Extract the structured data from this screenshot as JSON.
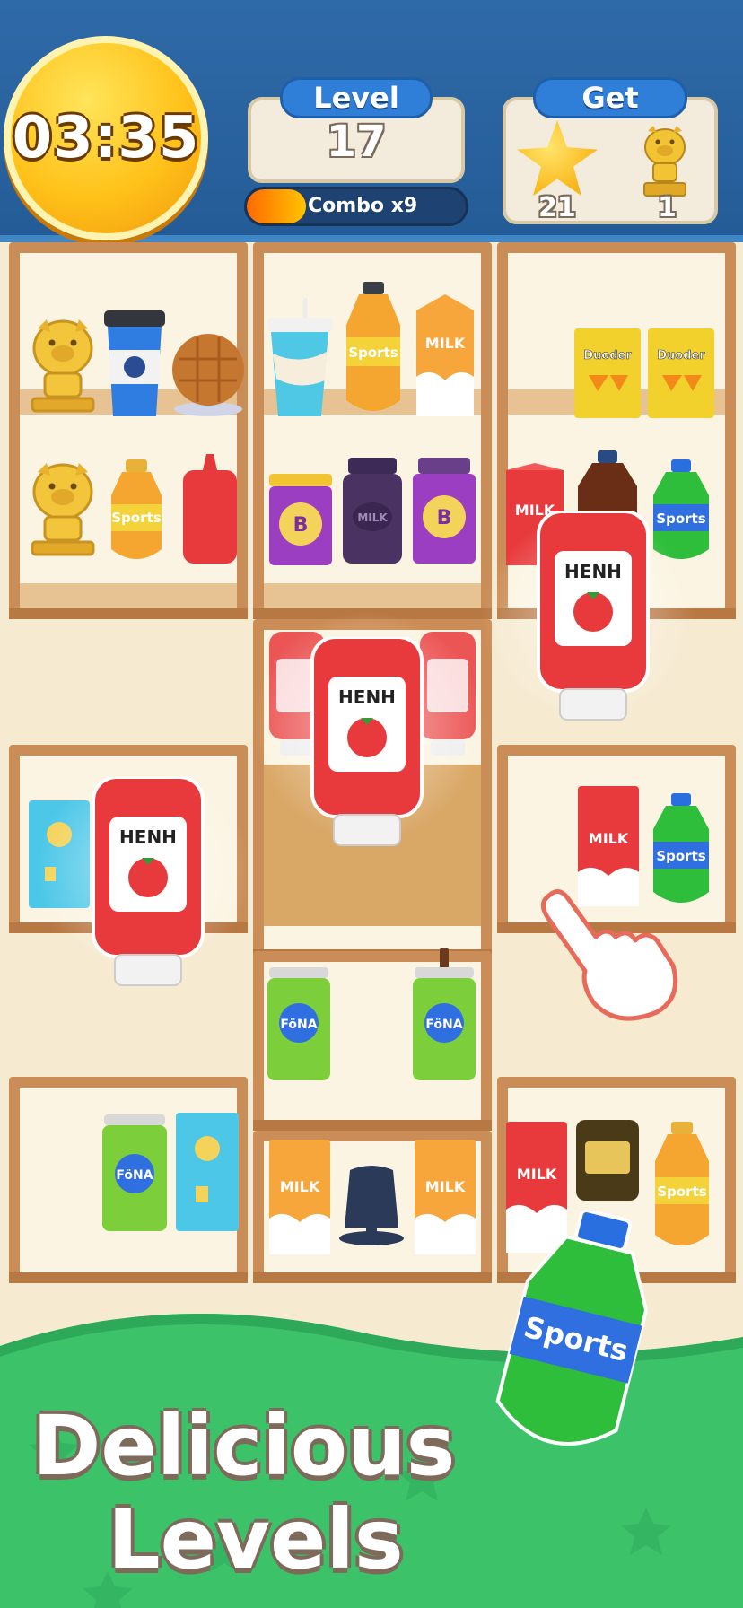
{
  "hud": {
    "timer": "03:35",
    "level_label": "Level",
    "level_value": "17",
    "combo_label": "Combo x9",
    "combo_fill": 0.27,
    "get_label": "Get",
    "rewards": [
      {
        "icon": "star-icon",
        "count": "21"
      },
      {
        "icon": "pig-trophy-icon",
        "count": "1"
      }
    ]
  },
  "items": {
    "sports": "Sports",
    "milk": "MILK",
    "chips": "Duoder",
    "ketchup": "HENH",
    "fona": "FöNA",
    "jar_letter": "B",
    "jar_milk": "MILK"
  },
  "banner": {
    "line1": "Delicious",
    "line2": "Levels"
  },
  "colors": {
    "header": "#2f6aa8",
    "shelf_wood": "#cb8d57",
    "banner_green": "#3cc36a"
  }
}
